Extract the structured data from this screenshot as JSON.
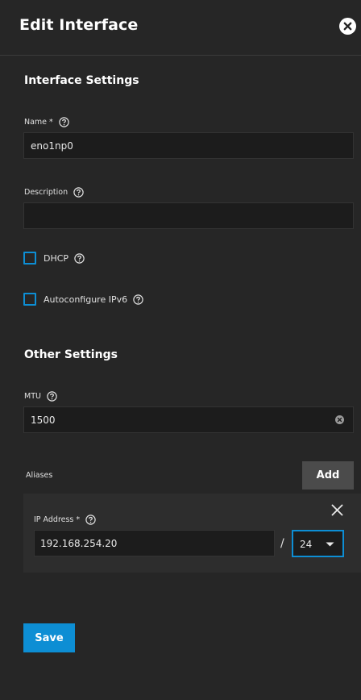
{
  "header": {
    "title": "Edit Interface",
    "close_icon": "close-circle-icon"
  },
  "interface_settings": {
    "title": "Interface Settings",
    "name": {
      "label": "Name *",
      "value": "eno1np0"
    },
    "description": {
      "label": "Description",
      "value": "",
      "placeholder": ""
    },
    "dhcp": {
      "label": "DHCP",
      "checked": false
    },
    "autoconfigure_ipv6": {
      "label": "Autoconfigure IPv6",
      "checked": false
    }
  },
  "other_settings": {
    "title": "Other Settings",
    "mtu": {
      "label": "MTU",
      "value": "1500"
    }
  },
  "aliases": {
    "label": "Aliases",
    "add_label": "Add",
    "items": [
      {
        "ip_label": "IP Address *",
        "ip_value": "192.168.254.20",
        "separator": "/",
        "netmask": "24"
      }
    ]
  },
  "footer": {
    "save_label": "Save"
  },
  "colors": {
    "background": "#262626",
    "input_bg": "#1c1c1c",
    "accent": "#0d8ed4",
    "add_button": "#4b4b4b",
    "card_bg": "#2d2d2d"
  }
}
